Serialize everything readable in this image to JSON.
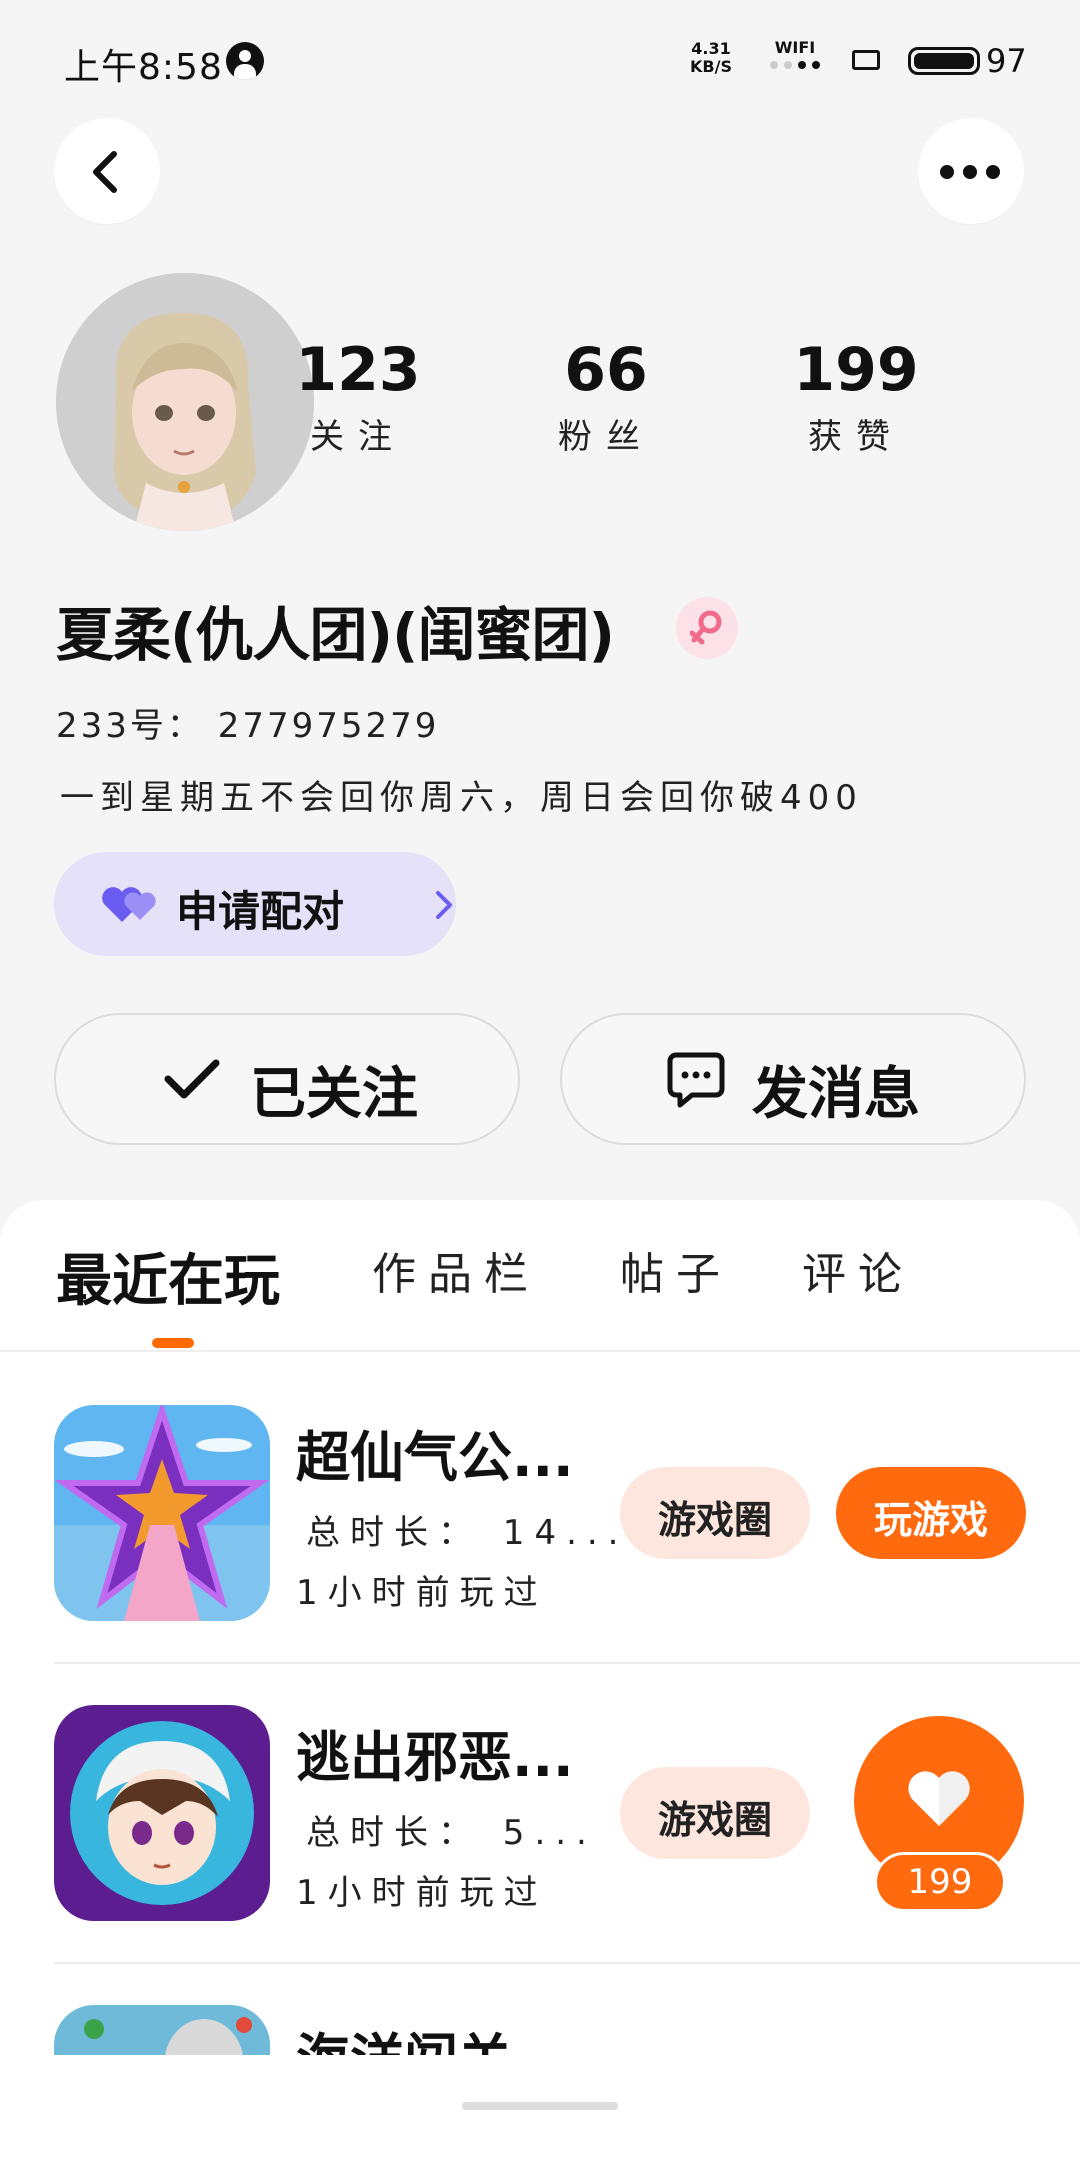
{
  "status_bar": {
    "time": "上午8:58",
    "net_speed_value": "4.31",
    "net_speed_unit": "KB/S",
    "wifi_label": "WIFI",
    "battery": "97"
  },
  "profile": {
    "stats": [
      {
        "value": "123",
        "label": "关注"
      },
      {
        "value": "66",
        "label": "粉丝"
      },
      {
        "value": "199",
        "label": "获赞"
      }
    ],
    "nickname": "夏柔(仇人团)(闺蜜团)",
    "uid": "233号： 277975279",
    "bio": "一到星期五不会回你周六，周日会回你破400",
    "pair_button": "申请配对"
  },
  "actions": {
    "followed_label": "已关注",
    "message_label": "发消息"
  },
  "tabs": [
    {
      "label": "最近在玩",
      "active": true
    },
    {
      "label": "作品栏",
      "active": false
    },
    {
      "label": "帖子",
      "active": false
    },
    {
      "label": "评论",
      "active": false
    }
  ],
  "games": [
    {
      "name": "超仙气公...",
      "duration": "总时长： 14...",
      "last_played": "1小时前玩过",
      "circle_label": "游戏圈",
      "play_label": "玩游戏"
    },
    {
      "name": "逃出邪恶...",
      "duration": "总时长： 5...",
      "last_played": "1小时前玩过",
      "circle_label": "游戏圈"
    },
    {
      "name": "海洋闯关"
    }
  ],
  "like_fab": {
    "count": "199"
  },
  "colors": {
    "accent": "#ff6a0f",
    "pair_bg": "#e4e1f8",
    "circle_bg": "#fde6de",
    "gender_bg": "#fde1e8"
  }
}
